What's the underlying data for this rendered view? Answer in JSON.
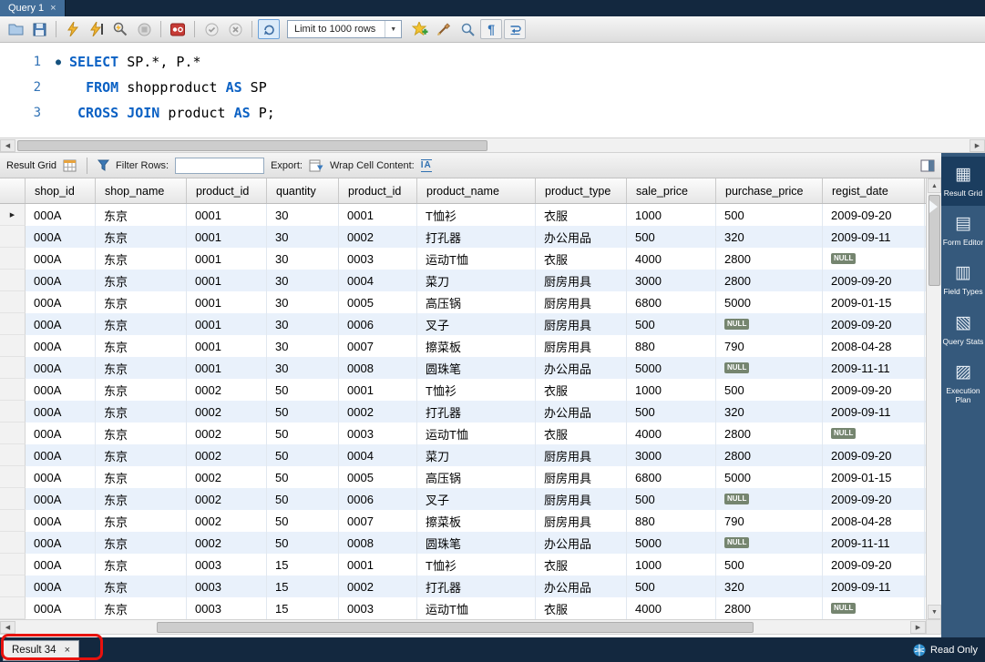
{
  "window": {
    "query_tab_label": "Query 1"
  },
  "icons": {
    "close": "×",
    "stmt_marker": "●",
    "row_marker": "▶",
    "dropdown_arrow": "▼",
    "scroll_up": "▲",
    "scroll_down": "▼",
    "scroll_left": "◀",
    "scroll_right": "▶",
    "pilcrow": "¶",
    "wrap_cell": "IA",
    "sidebar_result_grid": "▦",
    "sidebar_form_editor": "▤",
    "sidebar_field_types": "▥",
    "sidebar_query_stats": "▧",
    "sidebar_execution_plan": "▨"
  },
  "colors": {
    "keyword_blue": "#0b61c4",
    "titlebar_navy": "#13283f",
    "sidebar_blue": "#35597c",
    "alt_row_blue": "#e9f1fb",
    "annotation_red": "#e8120e",
    "null_badge": "#75856f"
  },
  "toolbar": {
    "limit_dropdown": "Limit to 1000 rows"
  },
  "editor": {
    "lines": [
      {
        "num": "1",
        "marker": true,
        "segments": [
          {
            "kw": true,
            "text": "SELECT"
          },
          {
            "kw": false,
            "text": " SP.*, P.*"
          }
        ]
      },
      {
        "num": "2",
        "marker": false,
        "segments": [
          {
            "kw": false,
            "text": "  "
          },
          {
            "kw": true,
            "text": "FROM"
          },
          {
            "kw": false,
            "text": " shopproduct "
          },
          {
            "kw": true,
            "text": "AS"
          },
          {
            "kw": false,
            "text": " SP"
          }
        ]
      },
      {
        "num": "3",
        "marker": false,
        "segments": [
          {
            "kw": false,
            "text": " "
          },
          {
            "kw": true,
            "text": "CROSS JOIN"
          },
          {
            "kw": false,
            "text": " product "
          },
          {
            "kw": true,
            "text": "AS"
          },
          {
            "kw": false,
            "text": " P;"
          }
        ]
      }
    ]
  },
  "result_toolbar": {
    "title": "Result Grid",
    "filter_label": "Filter Rows:",
    "filter_value": "",
    "export_label": "Export:",
    "wrap_label": "Wrap Cell Content:"
  },
  "grid": {
    "columns": [
      "shop_id",
      "shop_name",
      "product_id",
      "quantity",
      "product_id",
      "product_name",
      "product_type",
      "sale_price",
      "purchase_price",
      "regist_date"
    ],
    "rows": [
      [
        "000A",
        "东京",
        "0001",
        "30",
        "0001",
        "T恤衫",
        "衣服",
        "1000",
        "500",
        "2009-09-20"
      ],
      [
        "000A",
        "东京",
        "0001",
        "30",
        "0002",
        "打孔器",
        "办公用品",
        "500",
        "320",
        "2009-09-11"
      ],
      [
        "000A",
        "东京",
        "0001",
        "30",
        "0003",
        "运动T恤",
        "衣服",
        "4000",
        "2800",
        "NULL"
      ],
      [
        "000A",
        "东京",
        "0001",
        "30",
        "0004",
        "菜刀",
        "厨房用具",
        "3000",
        "2800",
        "2009-09-20"
      ],
      [
        "000A",
        "东京",
        "0001",
        "30",
        "0005",
        "高压锅",
        "厨房用具",
        "6800",
        "5000",
        "2009-01-15"
      ],
      [
        "000A",
        "东京",
        "0001",
        "30",
        "0006",
        "叉子",
        "厨房用具",
        "500",
        "NULL",
        "2009-09-20"
      ],
      [
        "000A",
        "东京",
        "0001",
        "30",
        "0007",
        "擦菜板",
        "厨房用具",
        "880",
        "790",
        "2008-04-28"
      ],
      [
        "000A",
        "东京",
        "0001",
        "30",
        "0008",
        "圆珠笔",
        "办公用品",
        "5000",
        "NULL",
        "2009-11-11"
      ],
      [
        "000A",
        "东京",
        "0002",
        "50",
        "0001",
        "T恤衫",
        "衣服",
        "1000",
        "500",
        "2009-09-20"
      ],
      [
        "000A",
        "东京",
        "0002",
        "50",
        "0002",
        "打孔器",
        "办公用品",
        "500",
        "320",
        "2009-09-11"
      ],
      [
        "000A",
        "东京",
        "0002",
        "50",
        "0003",
        "运动T恤",
        "衣服",
        "4000",
        "2800",
        "NULL"
      ],
      [
        "000A",
        "东京",
        "0002",
        "50",
        "0004",
        "菜刀",
        "厨房用具",
        "3000",
        "2800",
        "2009-09-20"
      ],
      [
        "000A",
        "东京",
        "0002",
        "50",
        "0005",
        "高压锅",
        "厨房用具",
        "6800",
        "5000",
        "2009-01-15"
      ],
      [
        "000A",
        "东京",
        "0002",
        "50",
        "0006",
        "叉子",
        "厨房用具",
        "500",
        "NULL",
        "2009-09-20"
      ],
      [
        "000A",
        "东京",
        "0002",
        "50",
        "0007",
        "擦菜板",
        "厨房用具",
        "880",
        "790",
        "2008-04-28"
      ],
      [
        "000A",
        "东京",
        "0002",
        "50",
        "0008",
        "圆珠笔",
        "办公用品",
        "5000",
        "NULL",
        "2009-11-11"
      ],
      [
        "000A",
        "东京",
        "0003",
        "15",
        "0001",
        "T恤衫",
        "衣服",
        "1000",
        "500",
        "2009-09-20"
      ],
      [
        "000A",
        "东京",
        "0003",
        "15",
        "0002",
        "打孔器",
        "办公用品",
        "500",
        "320",
        "2009-09-11"
      ],
      [
        "000A",
        "东京",
        "0003",
        "15",
        "0003",
        "运动T恤",
        "衣服",
        "4000",
        "2800",
        "NULL"
      ]
    ]
  },
  "sidebar": {
    "items": [
      {
        "label": "Result Grid",
        "icon": "sidebar_result_grid",
        "selected": true
      },
      {
        "label": "Form Editor",
        "icon": "sidebar_form_editor",
        "selected": false
      },
      {
        "label": "Field Types",
        "icon": "sidebar_field_types",
        "selected": false
      },
      {
        "label": "Query Stats",
        "icon": "sidebar_query_stats",
        "selected": false
      },
      {
        "label": "Execution Plan",
        "icon": "sidebar_execution_plan",
        "selected": false
      }
    ]
  },
  "statusbar": {
    "result_tab": "Result 34",
    "read_only": "Read Only"
  }
}
